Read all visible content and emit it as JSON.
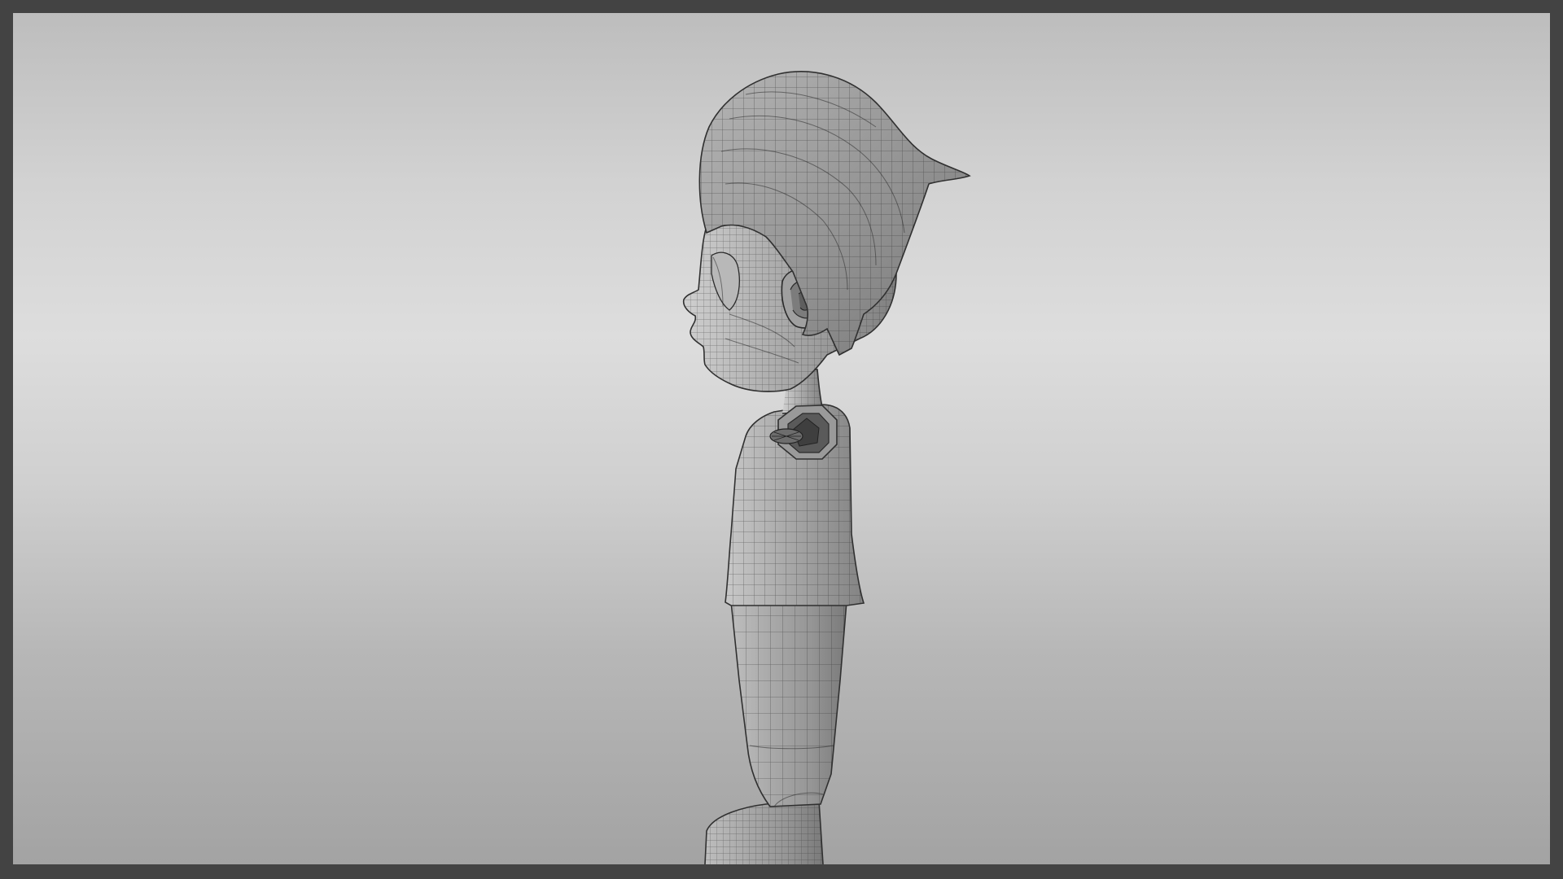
{
  "scene": {
    "object": "character-mesh",
    "view": "side",
    "display_mode": "wireframe-on-shaded",
    "colors": {
      "frame_border": "#434343",
      "background_top": "#bdbdbd",
      "background_mid": "#dddddd",
      "background_bottom": "#a3a3a3",
      "mesh_surface": "#a8a8a8",
      "wire": "#2b2b2b"
    }
  }
}
